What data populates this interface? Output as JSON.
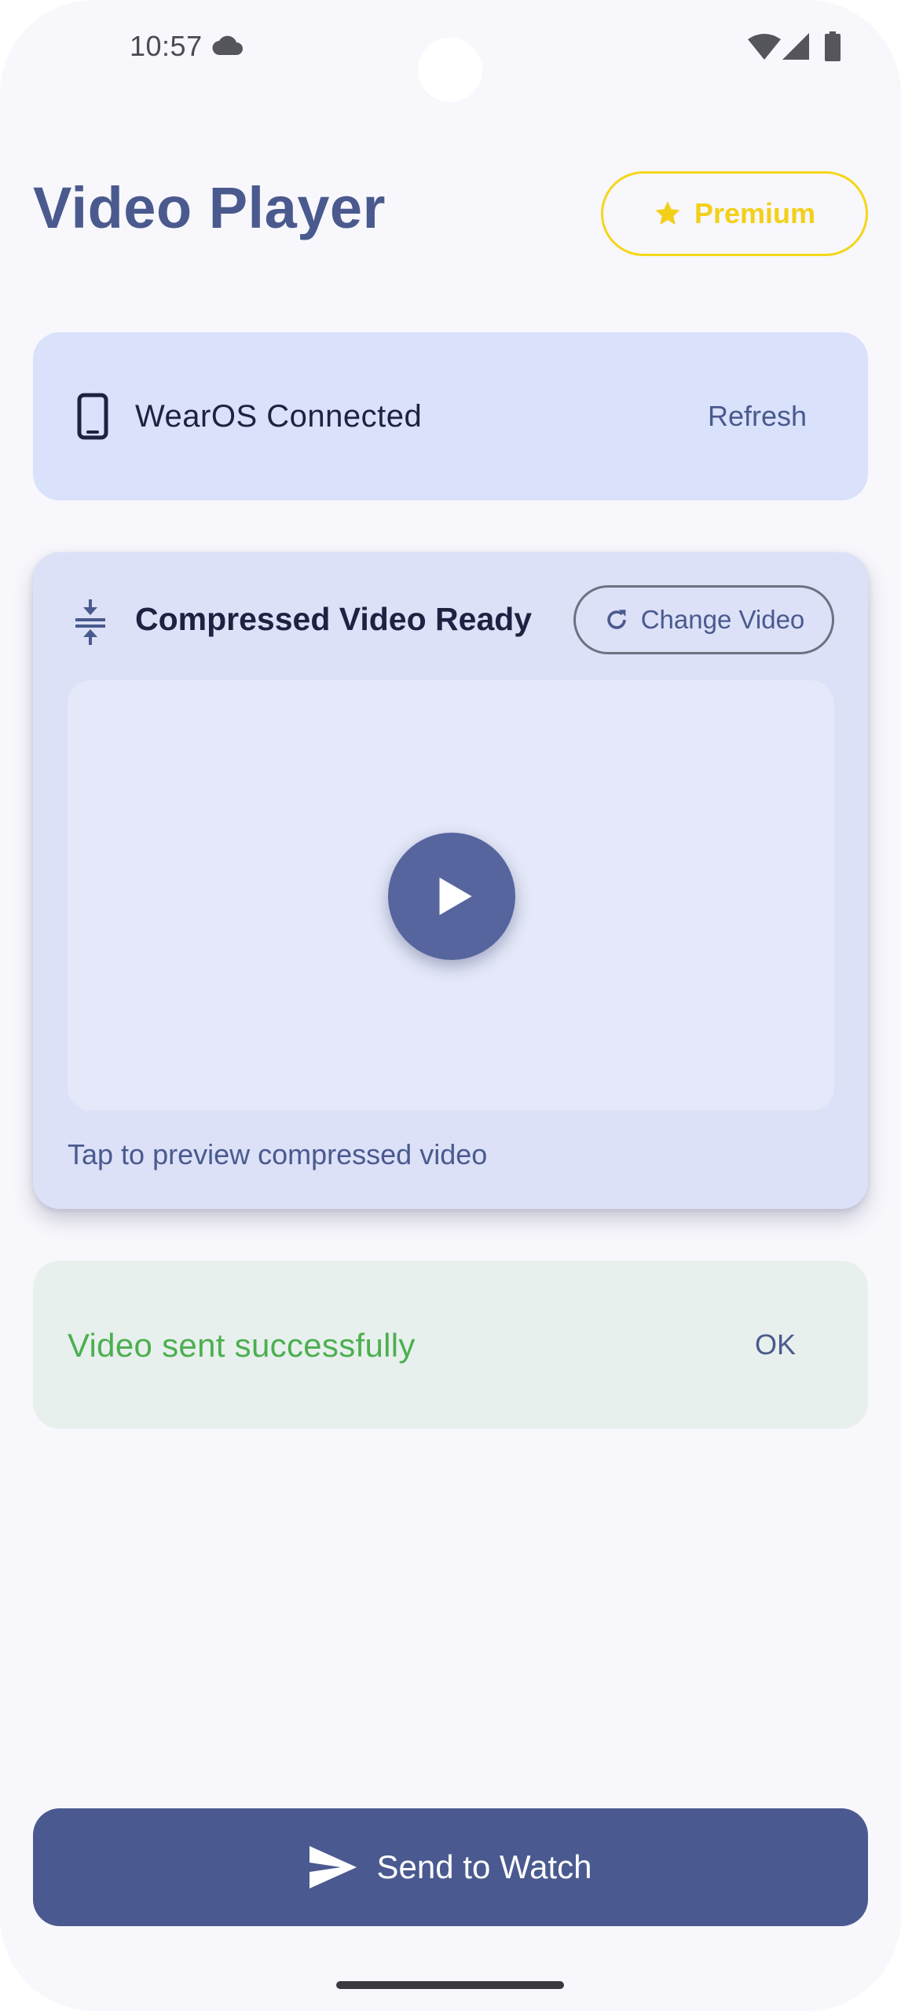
{
  "status_bar": {
    "time": "10:57",
    "icons": [
      "cloud-icon",
      "wifi-icon",
      "signal-icon",
      "battery-icon"
    ]
  },
  "header": {
    "title": "Video Player",
    "premium_label": "Premium",
    "premium_icon": "star-icon"
  },
  "connection": {
    "icon": "phone-icon",
    "status_label": "WearOS Connected",
    "refresh_label": "Refresh"
  },
  "video_card": {
    "icon": "compress-icon",
    "title": "Compressed Video Ready",
    "change_label": "Change Video",
    "change_icon": "refresh-icon",
    "play_icon": "play-icon",
    "hint": "Tap to preview compressed video"
  },
  "success_banner": {
    "message": "Video sent successfully",
    "ok_label": "OK"
  },
  "send_button": {
    "label": "Send to Watch",
    "icon": "send-icon"
  },
  "colors": {
    "primary": "#4a5a90",
    "title": "#4a5a8e",
    "premium": "#f2d01a",
    "success": "#4caf50",
    "connection_card": "#d9e1fb",
    "video_card": "#dce1f8",
    "success_card": "#e8f0ed",
    "background": "#f8f7fc"
  }
}
